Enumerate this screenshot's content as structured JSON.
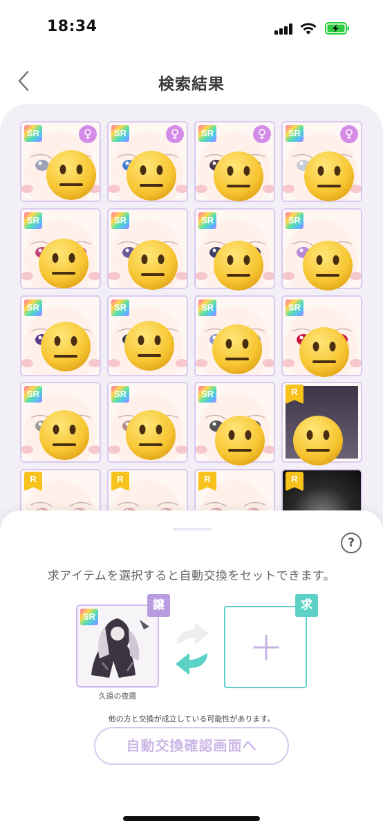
{
  "status_bar": {
    "time": "18:34",
    "battery_color": "#2ecc40"
  },
  "header": {
    "title": "検索結果",
    "back_icon": "chevron-left-icon"
  },
  "grid": {
    "items": [
      {
        "rarity": "SR",
        "female": true,
        "eye_color": "#9fa3b8"
      },
      {
        "rarity": "SR",
        "female": true,
        "eye_color": "#4a7fd0"
      },
      {
        "rarity": "SR",
        "female": true,
        "eye_color": "#4b3a4f"
      },
      {
        "rarity": "SR",
        "female": true,
        "eye_color": "#c8cbd8"
      },
      {
        "rarity": "SR",
        "female": false,
        "eye_color": "#c0437a"
      },
      {
        "rarity": "SR",
        "female": false,
        "eye_color": "#6a5a9a"
      },
      {
        "rarity": "SR",
        "female": false,
        "eye_color": "#3e3e66"
      },
      {
        "rarity": "SR",
        "female": false,
        "eye_color": "#b88ad8"
      },
      {
        "rarity": "SR",
        "female": false,
        "eye_color": "#5a3c8c"
      },
      {
        "rarity": "SR",
        "female": false,
        "eye_color": "#3a3a48"
      },
      {
        "rarity": "SR",
        "female": false,
        "eye_color": "#8a9ad0"
      },
      {
        "rarity": "SR",
        "female": false,
        "eye_color": "#c4173f"
      },
      {
        "rarity": "SR",
        "female": false,
        "eye_color": "#9b9b9b"
      },
      {
        "rarity": "SR",
        "female": false,
        "eye_color": "#b28a88"
      },
      {
        "rarity": "SR",
        "female": false,
        "eye_color": "#555555"
      },
      {
        "rarity": "R",
        "female": false,
        "scene": "space"
      },
      {
        "rarity": "R",
        "female": false,
        "eye_color": "#e0b0b0"
      },
      {
        "rarity": "R",
        "female": false,
        "eye_color": "#e0b0b0"
      },
      {
        "rarity": "R",
        "female": false,
        "eye_color": "#e0b0b0"
      },
      {
        "rarity": "R",
        "female": false,
        "scene": "dark"
      }
    ]
  },
  "sheet": {
    "help_label": "?",
    "instruction": "求アイテムを選択すると自動交換をセットできます。",
    "give": {
      "tag": "譲",
      "rarity": "SR",
      "item_name": "久遠の夜霧"
    },
    "want": {
      "tag": "求"
    },
    "notice": "他の方と交換が成立している可能性があります。",
    "confirm_button": "自動交換確認画面へ",
    "give_color": "#b99bdf",
    "want_color": "#5cd2c6"
  }
}
